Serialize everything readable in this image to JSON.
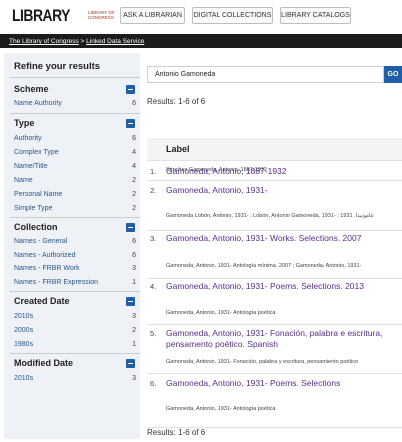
{
  "header": {
    "logo_main": "LIBRARY",
    "logo_sub": "LIBRARY OF CONGRESS",
    "buttons": [
      "ASK A LIBRARIAN",
      "DIGITAL COLLECTIONS",
      "LIBRARY CATALOGS"
    ],
    "breadcrumb": [
      "The Library of Congress",
      "Linked Data Service"
    ],
    "breadcrumb_sep": ">"
  },
  "sidebar": {
    "title": "Refine your results",
    "groups": [
      {
        "heading": "Scheme",
        "items": [
          {
            "label": "Name Authority",
            "count": "6"
          }
        ]
      },
      {
        "heading": "Type",
        "items": [
          {
            "label": "Authority",
            "count": "6"
          },
          {
            "label": "Complex Type",
            "count": "4"
          },
          {
            "label": "Name/Title",
            "count": "4"
          },
          {
            "label": "Name",
            "count": "2"
          },
          {
            "label": "Personal Name",
            "count": "2"
          },
          {
            "label": "Simple Type",
            "count": "2"
          }
        ]
      },
      {
        "heading": "Collection",
        "items": [
          {
            "label": "Names - General",
            "count": "6"
          },
          {
            "label": "Names - Authorized",
            "count": "6"
          },
          {
            "label": "Names - FRBR Work",
            "count": "3"
          },
          {
            "label": "Names - FRBR Expression",
            "count": "1"
          }
        ]
      },
      {
        "heading": "Created Date",
        "items": [
          {
            "label": "2010s",
            "count": "3"
          },
          {
            "label": "2000s",
            "count": "2"
          },
          {
            "label": "1980s",
            "count": "1"
          }
        ]
      },
      {
        "heading": "Modified Date",
        "items": [
          {
            "label": "2010s",
            "count": "3"
          }
        ]
      }
    ]
  },
  "search": {
    "value": "Antonio Gamoneda",
    "go_label": "GO"
  },
  "results": {
    "summary_top": "Results: 1-6 of 6",
    "summary_bottom": "Results: 1-6 of 6",
    "column_label": "Label",
    "rows": [
      {
        "num": "1.",
        "title": "Gamoneda, Antonio, 1887-1932",
        "sub": "Sánchez Gamoneda, Antonio, 1887-1932"
      },
      {
        "num": "2.",
        "title": "Gamoneda, Antonio, 1931-",
        "sub": "Gamoneda Lobón, Antonio, 1931- ; Lobón, Antonio Gamoneda, 1931- ; 1931 ,غامونيدا"
      },
      {
        "num": "3.",
        "title": "Gamoneda, Antonio, 1931- Works. Selections. 2007",
        "sub": "Gamoneda, Antonio, 1931- Antología mínima. 2007 ; Gamoneda, Antonio, 1931-"
      },
      {
        "num": "4.",
        "title": "Gamoneda, Antonio, 1931- Poems. Selections. 2013",
        "sub": "Gamoneda, Antonio, 1931- Antología poética"
      },
      {
        "num": "5.",
        "title": "Gamoneda, Antonio, 1931- Fonación, palabra e escritura, pensamento poético. Spanish",
        "sub": "Gamoneda, Antonio, 1931- Fonación, palabra y escritura, pensamiento poético"
      },
      {
        "num": "6.",
        "title": "Gamoneda, Antonio, 1931- Poems. Selections",
        "sub": "Gamoneda, Antonio, 1931- Antología poética"
      }
    ]
  }
}
